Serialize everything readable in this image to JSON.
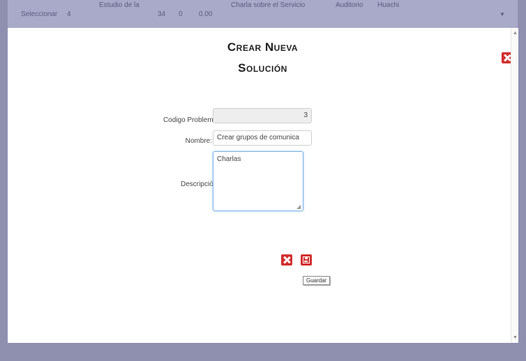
{
  "background_row": {
    "cells": [
      "Seleccionar",
      "4",
      "Estudio de la",
      "34",
      "0",
      "0.00",
      "Charla sobre el Servicio",
      "Auditorio",
      "Huachi"
    ]
  },
  "modal": {
    "title_line1": "Crear Nueva",
    "title_line2": "Solución"
  },
  "form": {
    "codigo_label": "Codigo Problema:",
    "codigo_value": "3",
    "nombre_label": "Nombre:",
    "nombre_value": "Crear grupos de comunica",
    "descripcion_label": "Descripción:",
    "descripcion_value": "Charlas"
  },
  "actions": {
    "save_tooltip": "Guardar"
  },
  "icons": {
    "close": "close-icon",
    "cancel": "cancel-icon",
    "save": "save-icon"
  },
  "colors": {
    "accent_red": "#d32f2f",
    "frame": "#8f8fb0"
  }
}
